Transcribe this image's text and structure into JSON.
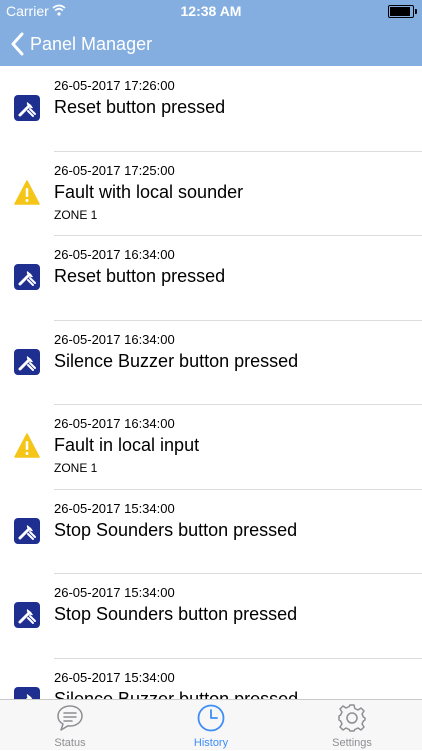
{
  "status_bar": {
    "carrier": "Carrier",
    "wifi_icon": "wifi-icon",
    "time": "12:38 AM",
    "battery_icon": "battery-icon"
  },
  "nav": {
    "back_icon": "chevron-left-icon",
    "back_label": "Panel Manager"
  },
  "colors": {
    "header_bg": "#84aee0",
    "wrench_icon_bg": "#1f2f8f",
    "warning_icon": "#f5c518",
    "tab_active": "#3e8ef7",
    "tab_inactive": "#8e8e93"
  },
  "events": [
    {
      "icon": "wrench-icon",
      "time": "26-05-2017 17:26:00",
      "title": "Reset button pressed",
      "zone": ""
    },
    {
      "icon": "warning-icon",
      "time": "26-05-2017 17:25:00",
      "title": "Fault with local sounder",
      "zone": "ZONE 1"
    },
    {
      "icon": "wrench-icon",
      "time": "26-05-2017 16:34:00",
      "title": "Reset button pressed",
      "zone": ""
    },
    {
      "icon": "wrench-icon",
      "time": "26-05-2017 16:34:00",
      "title": "Silence Buzzer button pressed",
      "zone": ""
    },
    {
      "icon": "warning-icon",
      "time": "26-05-2017 16:34:00",
      "title": "Fault in local input",
      "zone": "ZONE 1"
    },
    {
      "icon": "wrench-icon",
      "time": "26-05-2017 15:34:00",
      "title": "Stop Sounders button pressed",
      "zone": ""
    },
    {
      "icon": "wrench-icon",
      "time": "26-05-2017 15:34:00",
      "title": "Stop Sounders button pressed",
      "zone": ""
    },
    {
      "icon": "wrench-icon",
      "time": "26-05-2017 15:34:00",
      "title": "Silence Buzzer button pressed",
      "zone": ""
    }
  ],
  "tabs": [
    {
      "label": "Status",
      "icon": "chat-bubble-icon",
      "active": false
    },
    {
      "label": "History",
      "icon": "clock-icon",
      "active": true
    },
    {
      "label": "Settings",
      "icon": "gear-icon",
      "active": false
    }
  ]
}
